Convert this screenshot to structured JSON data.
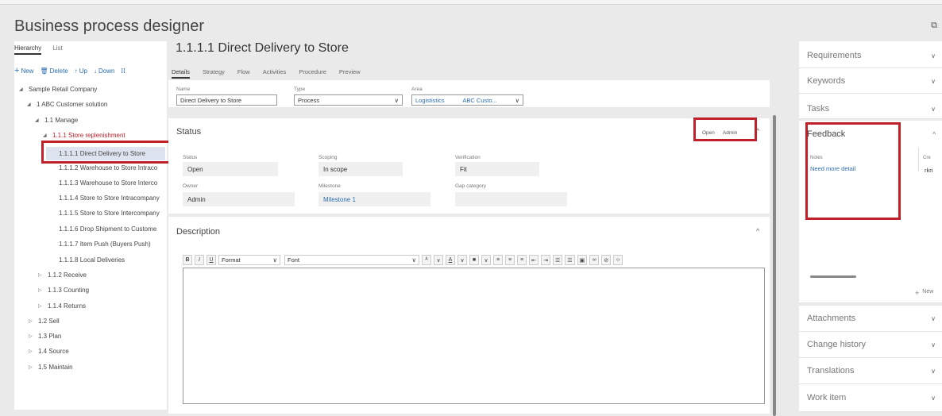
{
  "app": {
    "title": "Business process designer",
    "corner_icon": "⧉"
  },
  "left": {
    "tabs": [
      "Hierarchy",
      "List"
    ],
    "toolbar": {
      "new": "New",
      "delete": "Delete",
      "up": "Up",
      "down": "Down"
    },
    "tree": [
      {
        "label": "Sample Retail Company",
        "arrow": "◢"
      },
      {
        "label": "1 ABC Customer solution",
        "arrow": "◢"
      },
      {
        "label": "1.1 Manage",
        "arrow": "◢"
      },
      {
        "label": "1.1.1 Store replenishment",
        "arrow": "◢"
      },
      {
        "label": "1.1.1.1 Direct Delivery to Store",
        "arrow": ""
      },
      {
        "label": "1.1.1.2 Warehouse to Store Intraco",
        "arrow": ""
      },
      {
        "label": "1.1.1.3 Warehouse to Store Interco",
        "arrow": ""
      },
      {
        "label": "1.1.1.4 Store to Store Intracompany",
        "arrow": ""
      },
      {
        "label": "1.1.1.5 Store to Store Intercompany",
        "arrow": ""
      },
      {
        "label": "1.1.1.6 Drop Shipment to Custome",
        "arrow": ""
      },
      {
        "label": "1.1.1.7 Item Push (Buyers Push)",
        "arrow": ""
      },
      {
        "label": "1.1.1.8 Local Deliveries",
        "arrow": ""
      },
      {
        "label": "1.1.2 Receive",
        "arrow": "▷"
      },
      {
        "label": "1.1.3 Counting",
        "arrow": "▷"
      },
      {
        "label": "1.1.4 Returns",
        "arrow": "▷"
      },
      {
        "label": "1.2 Sell",
        "arrow": "▷"
      },
      {
        "label": "1.3 Plan",
        "arrow": "▷"
      },
      {
        "label": "1.4 Source",
        "arrow": "▷"
      },
      {
        "label": "1.5 Maintain",
        "arrow": "▷"
      }
    ]
  },
  "main": {
    "record_title": "1.1.1.1 Direct Delivery to Store",
    "tabs": [
      "Details",
      "Strategy",
      "Flow",
      "Activities",
      "Procedure",
      "Preview"
    ],
    "header_fields": {
      "name_label": "Name",
      "name_value": "Direct Delivery to Store",
      "type_label": "Type",
      "type_value": "Process",
      "area_label": "Area",
      "area_value1": "Logististics",
      "area_value2": "ABC Custo..."
    },
    "status_section": {
      "title": "Status",
      "pill_status": "Open",
      "pill_owner": "Admin",
      "status_label": "Status",
      "status_value": "Open",
      "scoping_label": "Scoping",
      "scoping_value": "In scope",
      "verification_label": "Verification",
      "verification_value": "Fit",
      "owner_label": "Owner",
      "owner_value": "Admin",
      "milestone_label": "Milestone",
      "milestone_value": "Milestone 1",
      "gap_label": "Gap category",
      "gap_value": ""
    },
    "description_section": {
      "title": "Description",
      "format_label": "Format",
      "font_label": "Font"
    }
  },
  "right": {
    "requirements": "Requirements",
    "keywords": "Keywords",
    "tasks": "Tasks",
    "feedback": {
      "title": "Feedback",
      "col_notes": "Notes",
      "col_created": "Cre",
      "note": "Need more detail",
      "creator": "rkri",
      "new_label": "New"
    },
    "attachments": "Attachments",
    "change_history": "Change history",
    "translations": "Translations",
    "work_item": "Work item"
  },
  "colors": {
    "accent": "#2b6cb0",
    "highlight_box": "#c0202a"
  }
}
